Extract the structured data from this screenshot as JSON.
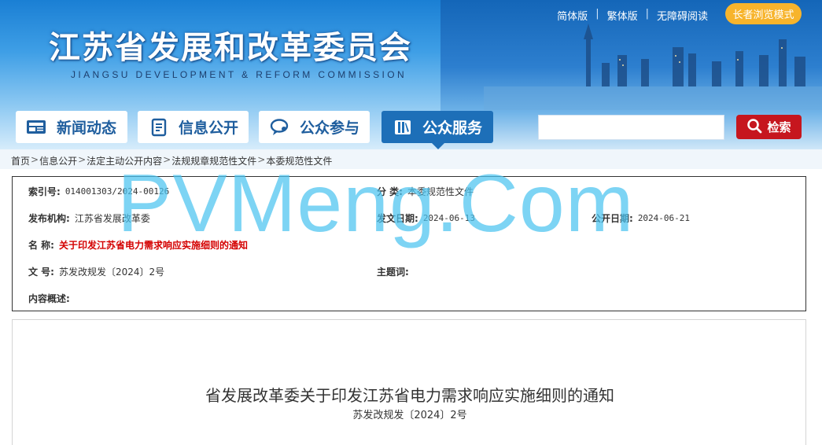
{
  "header": {
    "title_cn": "江苏省发展和改革委员会",
    "title_en": "JIANGSU DEVELOPMENT & REFORM COMMISSION",
    "links": [
      "简体版",
      "繁体版",
      "无障碍阅读"
    ],
    "separator": "|",
    "elder_mode": "长者浏览模式"
  },
  "nav": {
    "items": [
      {
        "label": "新闻动态",
        "icon": "news-icon"
      },
      {
        "label": "信息公开",
        "icon": "document-icon"
      },
      {
        "label": "公众参与",
        "icon": "chat-icon"
      },
      {
        "label": "公众服务",
        "icon": "book-icon"
      }
    ],
    "active_index": 3
  },
  "search": {
    "value": "",
    "button_label": "检索",
    "button_color": "#c6161e"
  },
  "breadcrumb": [
    "首页",
    "信息公开",
    "法定主动公开内容",
    "法规规章规范性文件",
    "本委规范性文件"
  ],
  "breadcrumb_sep": ">",
  "info": {
    "index_label": "索引号:",
    "index_value": "014001303/2024-00126",
    "category_label": "分  类:",
    "category_value": "本委规范性文件",
    "publisher_label": "发布机构:",
    "publisher_value": "江苏省发展改革委",
    "issue_date_label": "发文日期:",
    "issue_date_value": "2024-06-13",
    "public_date_label": "公开日期:",
    "public_date_value": "2024-06-21",
    "name_label": "名  称:",
    "name_value": "关于印发江苏省电力需求响应实施细则的通知",
    "docno_label": "文  号:",
    "docno_value": "苏发改规发〔2024〕2号",
    "keywords_label": "主题词:",
    "keywords_value": "",
    "summary_label": "内容概述:",
    "summary_value": ""
  },
  "content": {
    "title": "省发展改革委关于印发江苏省电力需求响应实施细则的通知",
    "doc_number": "苏发改规发〔2024〕2号"
  },
  "watermark": "PVMeng.Com",
  "colors": {
    "accent_blue": "#1d6fb8",
    "red_text": "#d40000",
    "elder_button": "#f7b42c"
  }
}
